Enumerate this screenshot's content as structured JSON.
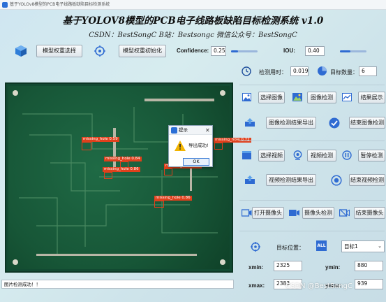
{
  "window": {
    "title": "基于YOLOv8模型的PCB电子线路板缺陷目标检测系统"
  },
  "header": {
    "title": "基于YOLOV8模型的PCB电子线路板缺陷目标检测系统 v1.0",
    "subtitle": "CSDN：BestSongC   B站：Bestsongc   微信公众号：BestSongC"
  },
  "toolbar": {
    "model_select_label": "模型权重选择",
    "model_init_label": "模型权重初始化",
    "confidence_label": "Confidence:",
    "confidence_value": "0.25",
    "confidence_level": 0.25,
    "iou_label": "IOU:",
    "iou_value": "0.40",
    "iou_level": 0.4
  },
  "stats": {
    "time_label": "检测用时：",
    "time_value": "0.019",
    "count_label": "目标数量：",
    "count_value": "6"
  },
  "image_section": {
    "select_label": "选择图像",
    "detect_label": "图像检测",
    "result_label": "结果展示",
    "export_label": "图像检测结果导出",
    "end_label": "结束图像检测"
  },
  "video_section": {
    "select_label": "选择视频",
    "detect_label": "视频检测",
    "pause_label": "暂停检测",
    "export_label": "视频检测结果导出",
    "end_label": "结束视频检测"
  },
  "camera_section": {
    "open_label": "打开摄像头",
    "detect_label": "摄像头检测",
    "end_label": "结束摄像头"
  },
  "target": {
    "position_label": "目标位置：",
    "all_badge": "ALL",
    "selected": "目标1",
    "xmin_label": "xmin:",
    "xmin_value": "2325",
    "ymin_label": "ymin:",
    "ymin_value": "880",
    "xmax_label": "xmax:",
    "xmax_value": "2383",
    "ymax_label": "ymax:",
    "ymax_value": "939"
  },
  "detections": [
    {
      "label": "missing_hole 0.59"
    },
    {
      "label": "missing_hole 0.84"
    },
    {
      "label": "missing_hole 0.85"
    },
    {
      "label": "missing_hole 0.86"
    },
    {
      "label": "missing_hole 0.72"
    },
    {
      "label": "missing_hole 0.86"
    }
  ],
  "dialog": {
    "title": "提示",
    "message": "导出成功!",
    "ok_label": "OK"
  },
  "status": {
    "text": "图片检测成功！！"
  },
  "watermark": "CSDN @BestSongC",
  "colors": {
    "accent": "#2f6bd2",
    "detection_box": "#e0401c",
    "pcb": "#175637"
  }
}
